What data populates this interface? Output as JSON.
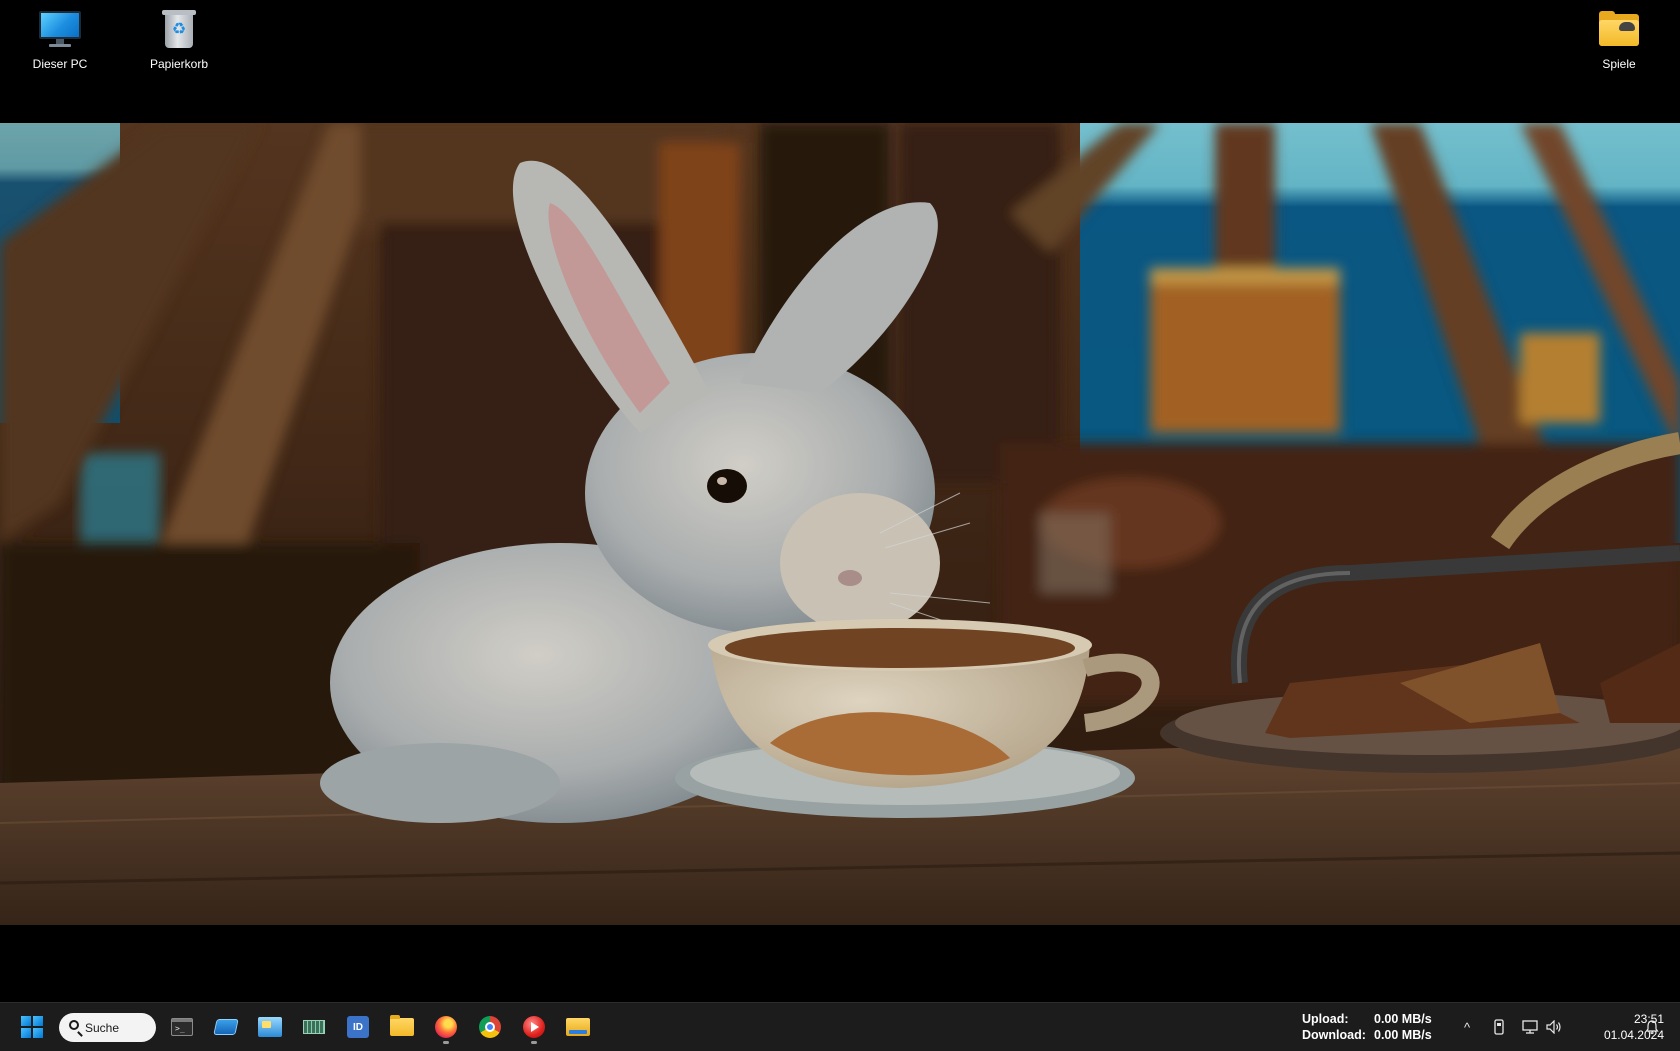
{
  "desktop": {
    "icons": [
      {
        "label": "Dieser PC",
        "icon": "monitor-icon"
      },
      {
        "label": "Papierkorb",
        "icon": "recycle-bin-icon"
      },
      {
        "label": "Spiele",
        "icon": "folder-icon"
      }
    ]
  },
  "taskbar": {
    "start_icon": "windows-start-icon",
    "search": {
      "placeholder": "Suche"
    },
    "apps": [
      {
        "name": "terminal",
        "icon": "terminal-icon",
        "running": false
      },
      {
        "name": "disk-tool",
        "icon": "disk-icon",
        "running": false
      },
      {
        "name": "control-panel",
        "icon": "control-panel-icon",
        "running": false
      },
      {
        "name": "memory-tool",
        "icon": "memory-icon",
        "running": false
      },
      {
        "name": "id-app",
        "icon": "id-card-icon",
        "label": "ID",
        "running": false
      },
      {
        "name": "file-explorer",
        "icon": "folder-icon",
        "running": false
      },
      {
        "name": "firefox",
        "icon": "firefox-icon",
        "running": true
      },
      {
        "name": "chrome",
        "icon": "chrome-icon",
        "running": false
      },
      {
        "name": "media-player",
        "icon": "media-player-icon",
        "running": true
      },
      {
        "name": "explorer",
        "icon": "explorer-icon",
        "running": false
      }
    ],
    "net_speed": {
      "upload_label": "Upload:",
      "upload_value": "0.00 MB/s",
      "download_label": "Download:",
      "download_value": "0.00 MB/s"
    },
    "tray": {
      "chevron": "^",
      "icons": [
        "usb-icon",
        "network-icon",
        "volume-icon"
      ]
    },
    "clock": {
      "time": "23:51",
      "date": "01.04.2024"
    },
    "notification_icon": "bell-icon"
  },
  "colors": {
    "taskbar_bg": "#1c1c1c",
    "desktop_bg": "#000000",
    "accent": "#0078d4"
  }
}
